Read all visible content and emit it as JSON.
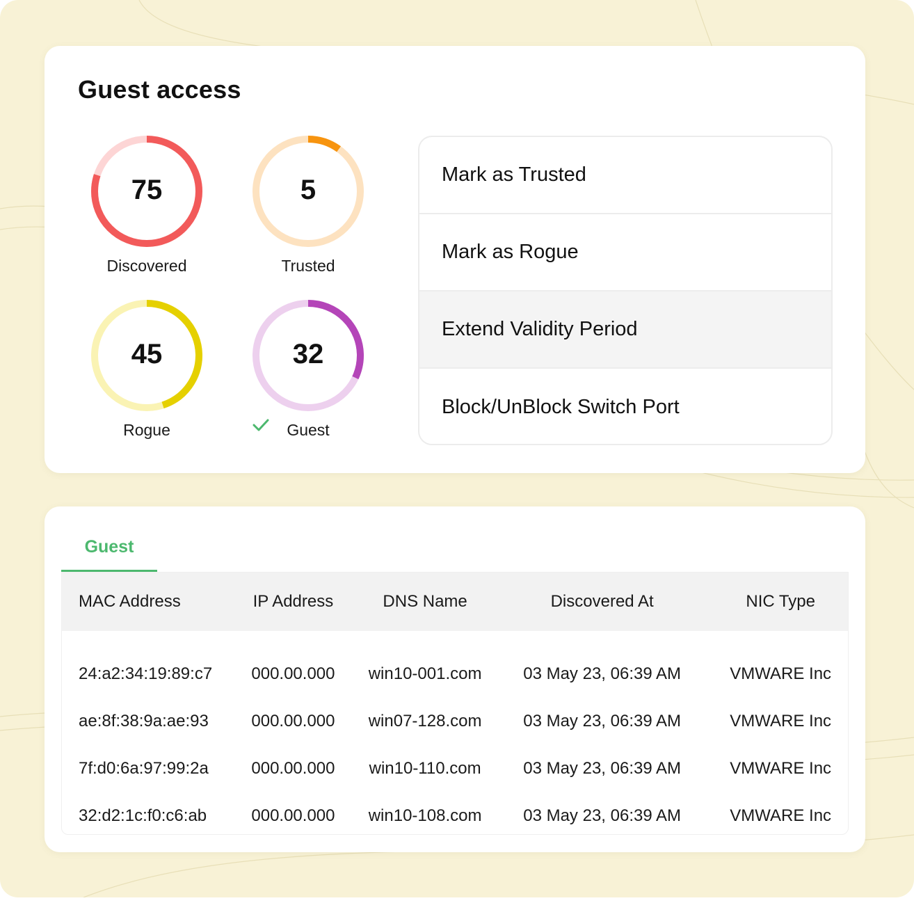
{
  "panel": {
    "title": "Guest access",
    "stats": [
      {
        "value": "75",
        "label": "Discovered",
        "fraction": 0.8,
        "color": "#f25a5a",
        "track": "#fdd5d5"
      },
      {
        "value": "5",
        "label": "Trusted",
        "fraction": 0.1,
        "color": "#f7940f",
        "track": "#fde2c0"
      },
      {
        "value": "45",
        "label": "Rogue",
        "fraction": 0.45,
        "color": "#e5d000",
        "track": "#faf3b4"
      },
      {
        "value": "32",
        "label": "Guest",
        "fraction": 0.32,
        "color": "#b445b8",
        "track": "#edd0ee",
        "selected_icon": "check-icon"
      }
    ],
    "actions": [
      {
        "label": "Mark as Trusted"
      },
      {
        "label": "Mark as Rogue"
      },
      {
        "label": "Extend Validity Period"
      },
      {
        "label": "Block/UnBlock Switch Port"
      }
    ]
  },
  "table": {
    "tab": "Guest",
    "columns": [
      "MAC Address",
      "IP Address",
      "DNS Name",
      "Discovered At",
      "NIC Type"
    ],
    "rows": [
      [
        "24:a2:34:19:89:c7",
        "000.00.000",
        "win10-001.com",
        "03 May 23, 06:39 AM",
        "VMWARE Inc"
      ],
      [
        "ae:8f:38:9a:ae:93",
        "000.00.000",
        "win07-128.com",
        "03 May 23, 06:39 AM",
        "VMWARE Inc"
      ],
      [
        "7f:d0:6a:97:99:2a",
        "000.00.000",
        "win10-110.com",
        "03 May 23, 06:39 AM",
        "VMWARE Inc"
      ],
      [
        "32:d2:1c:f0:c6:ab",
        "000.00.000",
        "win10-108.com",
        "03 May 23, 06:39 AM",
        "VMWARE Inc"
      ]
    ]
  },
  "colors": {
    "background": "#f8f2d6",
    "accent_green": "#4cb86e",
    "highlight_row": "#f4f4f4"
  }
}
